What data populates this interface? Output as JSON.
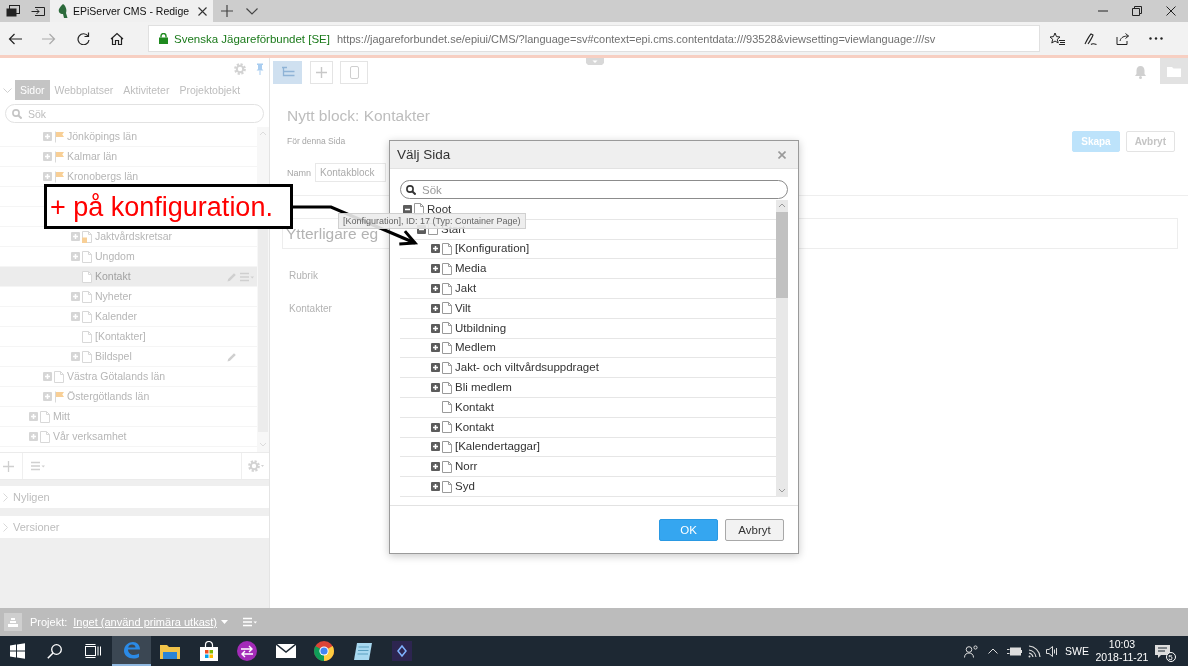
{
  "browser": {
    "tab": {
      "title": "EPiServer CMS - Redige"
    },
    "site_identity": "Svenska Jägareförbundet [SE]",
    "url": "https://jagareforbundet.se/epiui/CMS/?language=sv#context=epi.cms.contentdata:///93528&viewsetting=viewlanguage:///sv"
  },
  "left_panel": {
    "tabs": [
      {
        "label": "Sidor",
        "selected": true
      },
      {
        "label": "Webbplatser",
        "selected": false
      },
      {
        "label": "Aktiviteter",
        "selected": false
      },
      {
        "label": "Projektobjekt",
        "selected": false
      }
    ],
    "search": {
      "placeholder": "Sök"
    },
    "tree": [
      {
        "children": [
          {
            "label": "Jönköpings län",
            "kind": "container",
            "expanded": false,
            "selected": false
          },
          {
            "label": "Kalmar län",
            "kind": "container",
            "expanded": false,
            "selected": false
          },
          {
            "label": "Kronobergs län",
            "kind": "container",
            "expanded": false,
            "selected": false
          },
          {
            "children": [
              {
                "children": [
                  {
                    "label": "Jaktvårdskretsar",
                    "kind": "page_marked",
                    "expanded": false,
                    "selected": false
                  },
                  {
                    "label": "Ungdom",
                    "kind": "page",
                    "expanded": false,
                    "selected": false
                  },
                  {
                    "label": "Kontakt",
                    "kind": "page",
                    "leaf": true,
                    "selected": true,
                    "editing": true
                  },
                  {
                    "label": "Nyheter",
                    "kind": "page",
                    "expanded": false,
                    "selected": false
                  },
                  {
                    "label": "Kalender",
                    "kind": "page",
                    "expanded": false,
                    "selected": false
                  },
                  {
                    "label": "[Kontakter]",
                    "kind": "page",
                    "leaf": true,
                    "selected": false
                  },
                  {
                    "label": "Bildspel",
                    "kind": "page",
                    "expanded": false,
                    "selected": false,
                    "editing": true
                  }
                ]
              }
            ]
          },
          {
            "label": "Västra Götalands län",
            "kind": "page",
            "expanded": false,
            "selected": false
          },
          {
            "label": "Östergötlands län",
            "kind": "container",
            "expanded": false,
            "selected": false
          }
        ]
      },
      {
        "label": "Mitt",
        "kind": "page",
        "expanded": false,
        "selected": false
      },
      {
        "label": "Vår verksamhet",
        "kind": "page",
        "expanded": false,
        "selected": false
      }
    ],
    "sections": [
      {
        "label": "Nyligen",
        "expanded": false
      },
      {
        "label": "Versioner",
        "expanded": false
      }
    ]
  },
  "main": {
    "toolbar_buttons": [
      {
        "on": true
      },
      {
        "on": false
      },
      {
        "on": false
      }
    ],
    "heading": "Nytt block: Kontakter",
    "subheading": "För denna Sida",
    "name_field": {
      "label": "Namn",
      "value": "Kontakblock"
    },
    "buttons": [
      {
        "label": "Skapa",
        "kind": "primary"
      },
      {
        "label": "Avbryt",
        "kind": "secondary"
      }
    ],
    "group_title": "Ytterligare eg",
    "properties": [
      "Rubrik",
      "Kontakter"
    ]
  },
  "project_bar": {
    "label": "Projekt:",
    "value": "Inget (använd primära utkast)"
  },
  "dialog": {
    "title": "Välj Sida",
    "search": {
      "placeholder": "Sök"
    },
    "tree": [
      {
        "label": "Root",
        "kind": "page",
        "expanded": true,
        "selected": false,
        "children": [
          {
            "label": "Start",
            "kind": "page",
            "expanded": true,
            "selected": false,
            "children": [
              {
                "label": "[Konfiguration]",
                "kind": "page",
                "expanded": false,
                "selected": false
              },
              {
                "label": "Media",
                "kind": "page",
                "expanded": false,
                "selected": false
              },
              {
                "label": "Jakt",
                "kind": "page",
                "expanded": false,
                "selected": false
              },
              {
                "label": "Vilt",
                "kind": "page",
                "expanded": false,
                "selected": false
              },
              {
                "label": "Utbildning",
                "kind": "page",
                "expanded": false,
                "selected": false
              },
              {
                "label": "Medlem",
                "kind": "page",
                "expanded": false,
                "selected": false
              },
              {
                "label": "Jakt- och viltvårdsuppdraget",
                "kind": "page",
                "expanded": false,
                "selected": false
              },
              {
                "label": "Bli medlem",
                "kind": "page",
                "expanded": false,
                "selected": false
              },
              {
                "label": "Kontakt",
                "kind": "page",
                "leaf": true,
                "selected": false
              },
              {
                "label": "Kontakt",
                "kind": "page",
                "expanded": false,
                "selected": false
              },
              {
                "label": "[Kalendertaggar]",
                "kind": "page",
                "expanded": false,
                "selected": false
              },
              {
                "label": "Norr",
                "kind": "page",
                "expanded": false,
                "selected": false
              },
              {
                "label": "Syd",
                "kind": "page",
                "expanded": false,
                "selected": false
              }
            ]
          }
        ]
      }
    ],
    "tooltip": "[Konfiguration], ID: 17 (Typ: Container Page)",
    "buttons": [
      {
        "label": "OK",
        "kind": "primary"
      },
      {
        "label": "Avbryt",
        "kind": "secondary"
      }
    ]
  },
  "annotation": {
    "text": "+ på konfiguration."
  },
  "taskbar": {
    "apps": [
      {
        "active": true
      },
      {
        "active": false
      },
      {
        "active": false
      },
      {
        "active": false
      },
      {
        "active": false
      },
      {
        "active": false
      },
      {
        "active": false
      },
      {
        "active": false
      }
    ],
    "language": "SWE",
    "time": "10:03",
    "date": "2018-11-21",
    "notifications": "5"
  }
}
